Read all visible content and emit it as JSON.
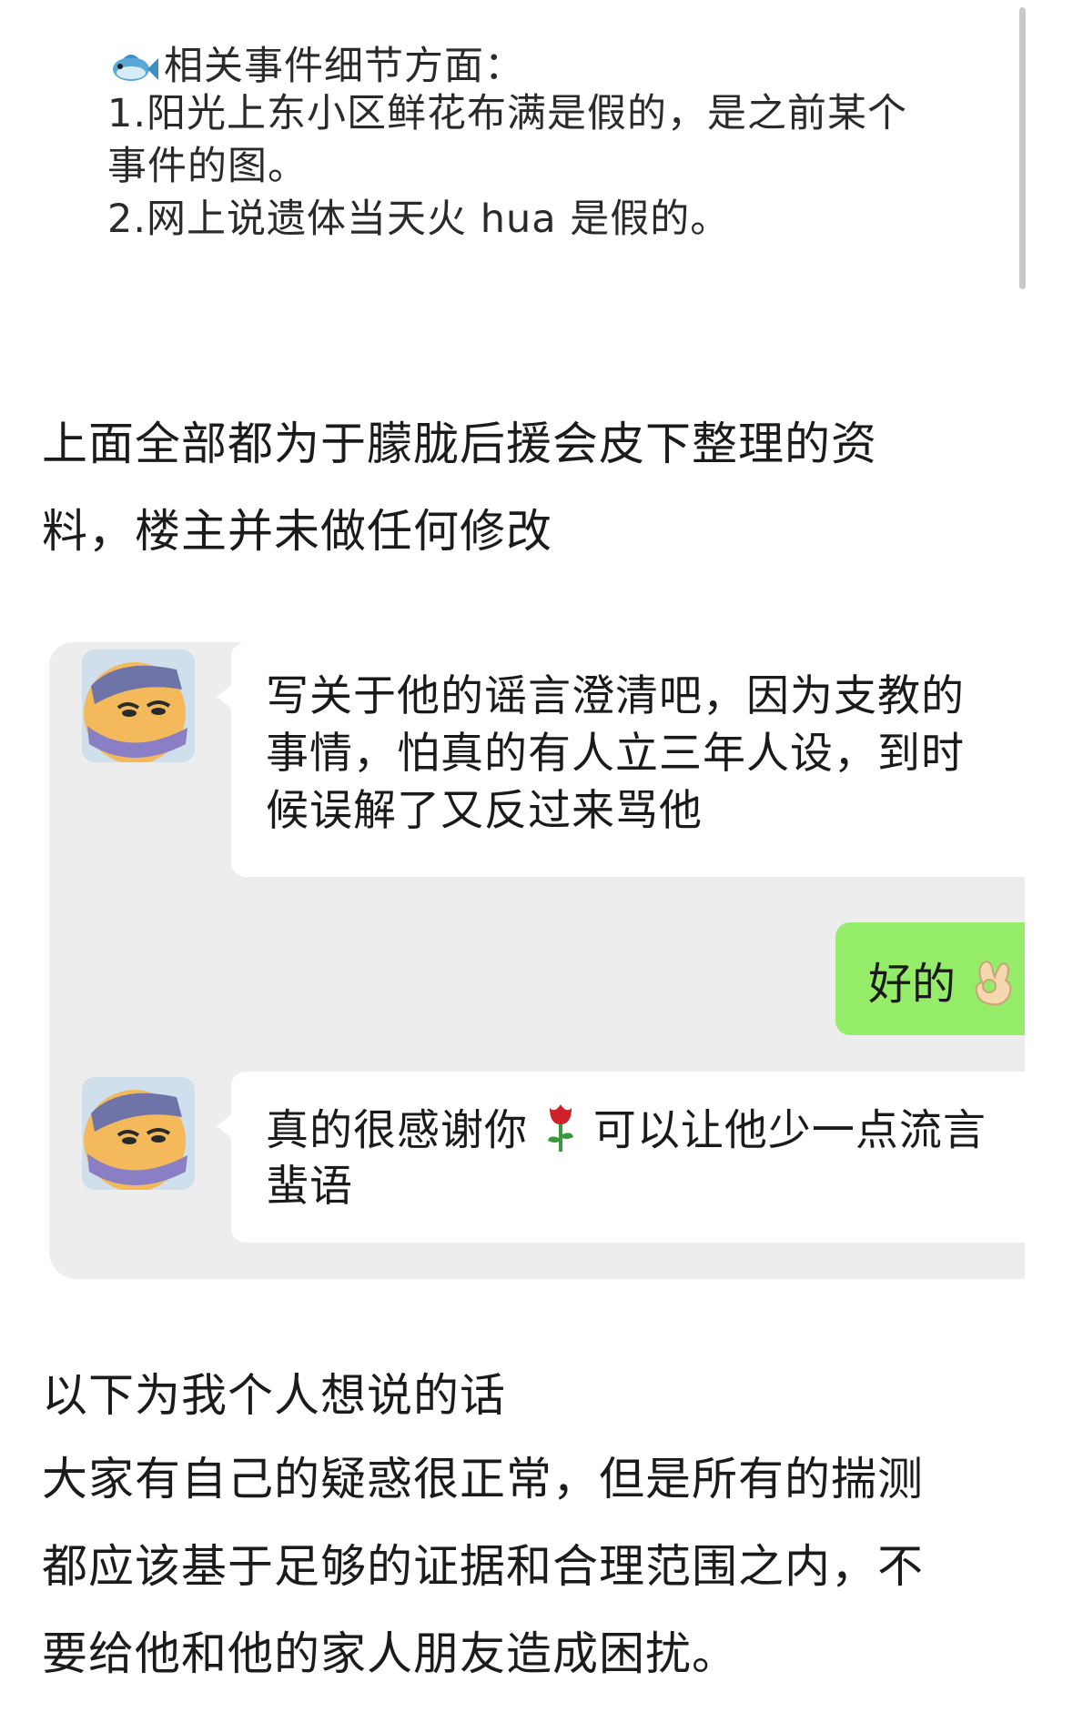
{
  "quote": {
    "heading": "相关事件细节方面：",
    "line1": "1.阳光上东小区鲜花布满是假的，是之前某个",
    "line2": "事件的图。",
    "line3": "2.网上说遗体当天火 hua 是假的。"
  },
  "intro": {
    "line1": "上面全部都为于朦胧后援会皮下整理的资",
    "line2": "料，楼主并未做任何修改"
  },
  "chat": {
    "msg1": {
      "line1": "写关于他的谣言澄清吧，因为支教的",
      "line2": "事情，怕真的有人立三年人设，到时",
      "line3": "候误解了又反过来骂他"
    },
    "reply": {
      "text": "好的"
    },
    "msg2": {
      "line1_a": "真的很感谢你",
      "line1_b": "可以让他少一点流言",
      "line2": "蜚语"
    }
  },
  "outro": {
    "line1": "以下为我个人想说的话",
    "line2": "大家有自己的疑惑很正常，但是所有的揣测",
    "line3": "都应该基于足够的证据和合理范围之内，不",
    "line4": "要给他和他的家人朋友造成困扰。"
  },
  "colors": {
    "chat_bg": "#ededed",
    "my_bubble": "#95ec69",
    "their_bubble": "#ffffff"
  },
  "icons": [
    "fish-icon",
    "avatar",
    "ok-hand-icon",
    "rose-icon"
  ]
}
